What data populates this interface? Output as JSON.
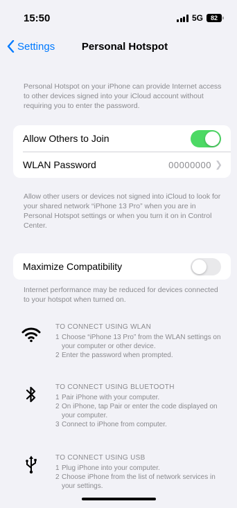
{
  "status": {
    "time": "15:50",
    "network": "5G",
    "battery": "82"
  },
  "nav": {
    "back_label": "Settings",
    "title": "Personal Hotspot"
  },
  "intro_text": "Personal Hotspot on your iPhone can provide Internet access to other devices signed into your iCloud account without requiring you to enter the password.",
  "main_group": {
    "allow_label": "Allow Others to Join",
    "allow_on": true,
    "password_label": "WLAN Password",
    "password_value": "00000000"
  },
  "allow_desc": "Allow other users or devices not signed into iCloud to look for your shared network “iPhone 13 Pro” when you are in Personal Hotspot settings or when you turn it on in Control Center.",
  "compat": {
    "label": "Maximize Compatibility",
    "on": false
  },
  "compat_desc": "Internet performance may be reduced for devices connected to your hotspot when turned on.",
  "connect": {
    "wlan": {
      "icon": "wifi-icon",
      "heading": "TO CONNECT USING WLAN",
      "steps": [
        {
          "num": "1",
          "text": "Choose “iPhone 13 Pro” from the WLAN settings on your computer or other device."
        },
        {
          "num": "2",
          "text": "Enter the password when prompted."
        }
      ]
    },
    "bluetooth": {
      "icon": "bluetooth-icon",
      "heading": "TO CONNECT USING BLUETOOTH",
      "steps": [
        {
          "num": "1",
          "text": "Pair iPhone with your computer."
        },
        {
          "num": "2",
          "text": "On iPhone, tap Pair or enter the code displayed on your computer."
        },
        {
          "num": "3",
          "text": "Connect to iPhone from computer."
        }
      ]
    },
    "usb": {
      "icon": "usb-icon",
      "heading": "TO CONNECT USING USB",
      "steps": [
        {
          "num": "1",
          "text": "Plug iPhone into your computer."
        },
        {
          "num": "2",
          "text": "Choose iPhone from the list of network services in your settings."
        }
      ]
    }
  }
}
